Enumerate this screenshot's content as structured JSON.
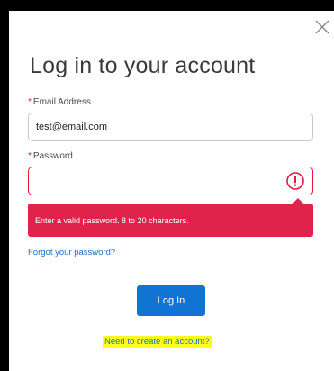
{
  "dialog": {
    "close_icon": "close-icon",
    "title": "Log in to your account"
  },
  "email": {
    "required_marker": "*",
    "label": "Email Address",
    "value": "test@email.com",
    "placeholder": ""
  },
  "password": {
    "required_marker": "*",
    "label": "Password",
    "value": "",
    "placeholder": "",
    "error_icon": "exclamation-circle-icon",
    "error_message": "Enter a valid password. 8 to 20 characters."
  },
  "links": {
    "forgot_password": "Forgot your password?",
    "create_account": "Need to create an account?"
  },
  "actions": {
    "login_label": "Log In"
  },
  "colors": {
    "backdrop": "#000000",
    "dialog_bg": "#ffffff",
    "error": "#e0234b",
    "primary_button": "#1173d4",
    "link": "#1b6fc9",
    "highlight": "#ffff1f"
  }
}
